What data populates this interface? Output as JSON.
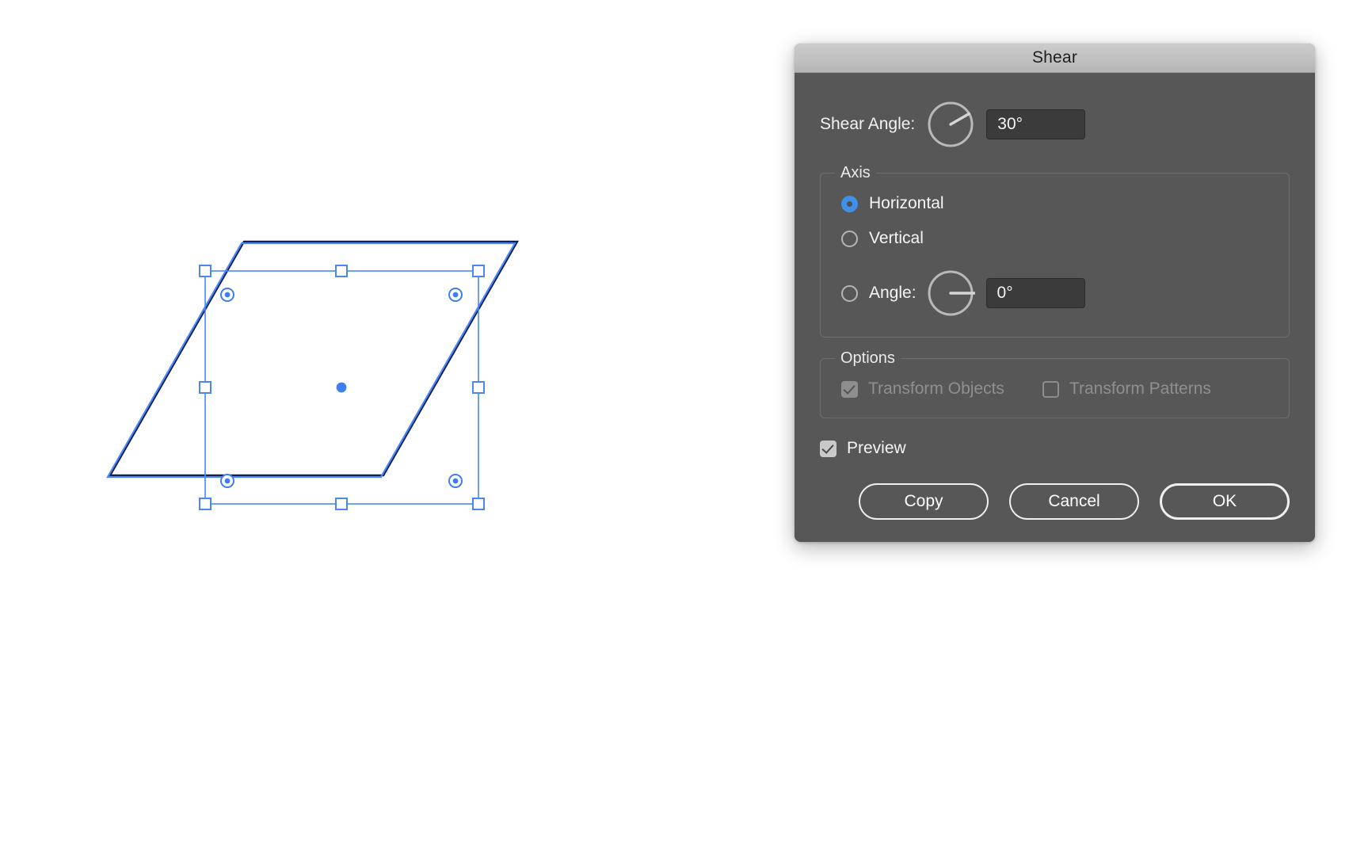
{
  "dialog": {
    "title": "Shear",
    "shear_angle": {
      "label": "Shear Angle:",
      "value": "30°",
      "placeholder": "0°",
      "dial_icon": "angle-dial-icon",
      "dial_degrees": 30
    },
    "axis_group": {
      "title": "Axis",
      "options": [
        {
          "label": "Horizontal",
          "selected": true
        },
        {
          "label": "Vertical",
          "selected": false
        },
        {
          "label": "Angle:",
          "selected": false
        }
      ],
      "angle_value": "0°",
      "angle_placeholder": "0°",
      "angle_dial_icon": "angle-dial-icon",
      "angle_dial_degrees": 0
    },
    "options_group": {
      "title": "Options",
      "checkboxes": [
        {
          "label": "Transform Objects",
          "checked": true,
          "disabled": true
        },
        {
          "label": "Transform Patterns",
          "checked": false,
          "disabled": true
        }
      ]
    },
    "preview": {
      "label": "Preview",
      "checked": true,
      "disabled": false
    },
    "buttons": [
      {
        "label": "Copy",
        "default": false
      },
      {
        "label": "Cancel",
        "default": false
      },
      {
        "label": "OK",
        "default": true
      }
    ]
  },
  "canvas": {
    "selection_color": "#4a86f7",
    "path_stroke_color": "#0c1a4a",
    "preview_stroke_color": "#4a86f7",
    "handle_fill": "#ffffff",
    "center_point_color": "#3d7ef0"
  }
}
